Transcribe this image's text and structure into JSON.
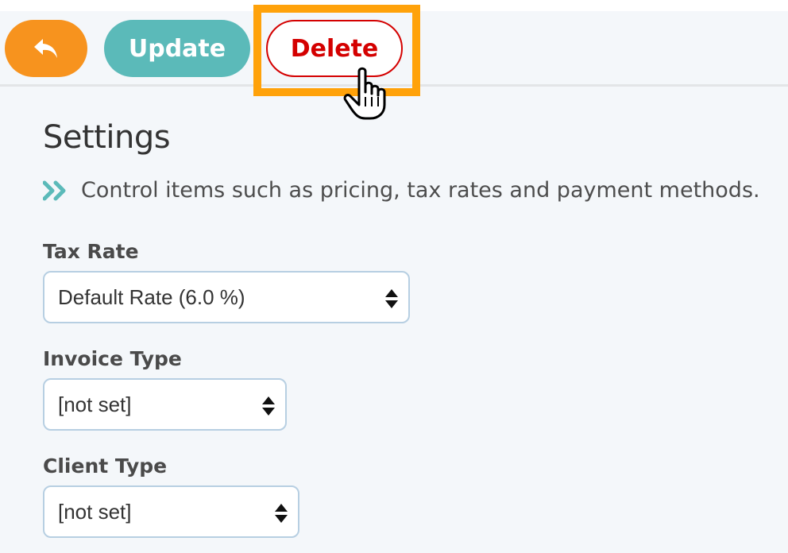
{
  "toolbar": {
    "back_icon": "undo-arrow-icon",
    "update_label": "Update",
    "delete_label": "Delete",
    "cursor_icon": "hand-pointer-icon"
  },
  "settings": {
    "title": "Settings",
    "subtitle_icon": "double-chevron-right-icon",
    "subtitle": "Control items such as pricing, tax rates and payment methods.",
    "fields": [
      {
        "label": "Tax Rate",
        "value": "Default Rate (6.0 %)"
      },
      {
        "label": "Invoice Type",
        "value": "[not set]"
      },
      {
        "label": "Client Type",
        "value": "[not set]"
      }
    ]
  },
  "colors": {
    "back": "#f7931e",
    "update": "#5bbab9",
    "delete": "#d40000",
    "highlight": "#ffa20a",
    "chevron": "#5bbab9",
    "background": "#f4f7fa"
  }
}
